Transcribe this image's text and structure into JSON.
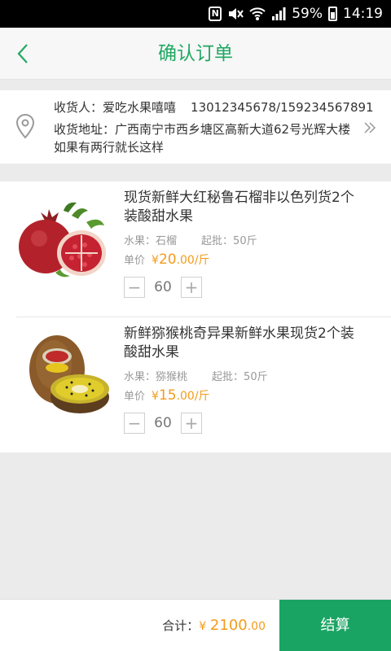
{
  "status_bar": {
    "battery": "59%",
    "time": "14:19",
    "nfc_label": "N"
  },
  "header": {
    "title": "确认订单"
  },
  "address": {
    "receiver_label": "收货人：",
    "receiver_name": "爱吃水果嘻嘻",
    "phone": "13012345678/159234567891",
    "address_label": "收货地址：",
    "address_text": "广西南宁市西乡塘区高新大道62号光辉大楼如果有两行就长这样"
  },
  "products": [
    {
      "name": "现货新鲜大红秘鲁石榴非以色列货2个装酸甜水果",
      "category_label": "水果：",
      "category": "石榴",
      "batch_label": "起批：",
      "batch": "50斤",
      "price_label": "单价",
      "currency": "¥",
      "price_int": "20",
      "price_dec": ".00",
      "unit": "/斤",
      "quantity": "60"
    },
    {
      "name": "新鲜猕猴桃奇异果新鲜水果现货2个装酸甜水果",
      "category_label": "水果：",
      "category": "猕猴桃",
      "batch_label": "起批：",
      "batch": "50斤",
      "price_label": "单价",
      "currency": "¥",
      "price_int": "15",
      "price_dec": ".00",
      "unit": "/斤",
      "quantity": "60"
    }
  ],
  "footer": {
    "total_label": "合计：",
    "currency": "¥",
    "total_int": "2100",
    "total_dec": ".00",
    "checkout_label": "结算"
  },
  "colors": {
    "accent": "#1aa463",
    "price": "#f39b1b"
  },
  "icons": [
    "back-icon",
    "location-pin-icon",
    "double-chevron-right-icon",
    "minus-icon",
    "plus-icon",
    "wifi-icon",
    "signal-icon",
    "battery-icon",
    "mute-icon",
    "nfc-icon"
  ]
}
